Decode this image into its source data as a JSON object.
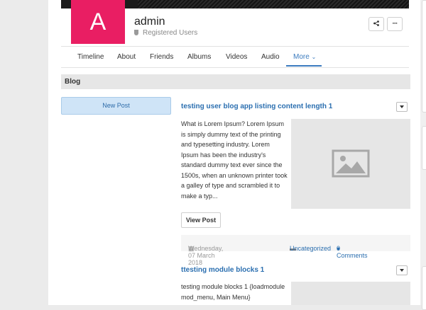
{
  "profile": {
    "avatar_letter": "A",
    "avatar_color": "#e91e63",
    "username": "admin",
    "usergroup": "Registered Users",
    "share_icon": "share-icon",
    "more_icon": "ellipsis-icon"
  },
  "nav": {
    "items": [
      "Timeline",
      "About",
      "Friends",
      "Albums",
      "Videos",
      "Audio",
      "More"
    ],
    "active": "More",
    "accent": "#3b7bbf"
  },
  "section": {
    "title": "Blog"
  },
  "sidebar": {
    "new_post_label": "New Post"
  },
  "posts": [
    {
      "title": "testing user blog app listing content length 1",
      "excerpt": "What is Lorem Ipsum? Lorem Ipsum is simply dummy text of the printing and typesetting industry. Lorem Ipsum has been the industry's standard dummy text ever since the 1500s, when an unknown printer took a galley of type and scrambled it to make a typ...",
      "view_label": "View Post",
      "date": "Wednesday, 07 March 2018",
      "category": "Uncategorized",
      "comments": "0 Comments"
    },
    {
      "title": "ttesting module blocks 1",
      "excerpt": "testing module blocks 1 {loadmodule mod_menu, Main Menu}"
    }
  ]
}
